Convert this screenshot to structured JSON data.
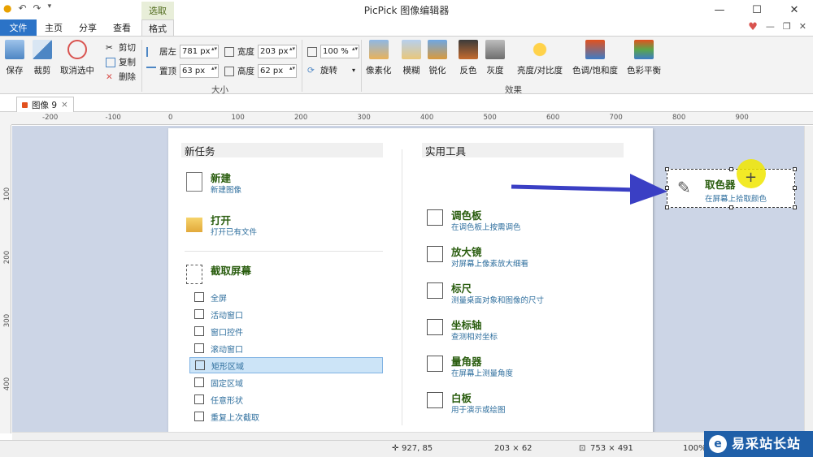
{
  "window": {
    "title": "PicPick 图像编辑器"
  },
  "tabs": {
    "file": "文件",
    "home": "主页",
    "share": "分享",
    "view": "查看",
    "context_group": "选取",
    "format": "格式"
  },
  "ribbon": {
    "save": "保存",
    "crop": "裁剪",
    "deselect": "取消选中",
    "cut": "剪切",
    "copy": "复制",
    "delete": "删除",
    "left_label": "居左",
    "left_value": "781 px",
    "top_label": "置顶",
    "top_value": "63 px",
    "width_label": "宽度",
    "width_value": "203 px",
    "height_label": "高度",
    "height_value": "62 px",
    "size_group": "大小",
    "zoom_value": "100 %",
    "rotate": "旋转",
    "pixelate": "像素化",
    "blur": "模糊",
    "sharpen": "锐化",
    "invert": "反色",
    "grayscale": "灰度",
    "brightness": "亮度/对比度",
    "hue": "色调/饱和度",
    "balance": "色彩平衡",
    "effects_group": "效果"
  },
  "document_tab": {
    "name": "图像 9",
    "close": "×"
  },
  "ruler": {
    "top": [
      "-200",
      "-100",
      "0",
      "100",
      "200",
      "300",
      "400",
      "500",
      "600",
      "700",
      "800",
      "900"
    ],
    "left": [
      "100",
      "200",
      "300",
      "400"
    ]
  },
  "panel": {
    "new_task_header": "新任务",
    "tools_header": "实用工具",
    "new": {
      "title": "新建",
      "desc": "新建图像"
    },
    "open": {
      "title": "打开",
      "desc": "打开已有文件"
    },
    "capture": {
      "title": "截取屏幕"
    },
    "capture_items": [
      "全屏",
      "活动窗口",
      "窗口控件",
      "滚动窗口",
      "矩形区域",
      "固定区域",
      "任意形状",
      "重复上次截取"
    ],
    "tools": [
      {
        "title": "调色板",
        "desc": "在调色板上按需调色"
      },
      {
        "title": "放大镜",
        "desc": "对屏幕上像素放大细看"
      },
      {
        "title": "标尺",
        "desc": "测量桌面对象和图像的尺寸"
      },
      {
        "title": "坐标轴",
        "desc": "查测相对坐标"
      },
      {
        "title": "量角器",
        "desc": "在屏幕上测量角度"
      },
      {
        "title": "白板",
        "desc": "用于演示或绘图"
      }
    ]
  },
  "picker": {
    "title": "取色器",
    "desc": "在屏幕上拾取颜色"
  },
  "status": {
    "cursor": "927, 85",
    "selection": "203 × 62",
    "image_size": "753 × 491",
    "zoom": "100%"
  },
  "watermark": {
    "text": "易采站长站"
  },
  "colors": {
    "accent": "#2b73c7",
    "canvas": "#ccd5e6",
    "arrow": "#3a3fc4",
    "title_green": "#2a5d0f",
    "desc_blue": "#2f6f9e"
  }
}
